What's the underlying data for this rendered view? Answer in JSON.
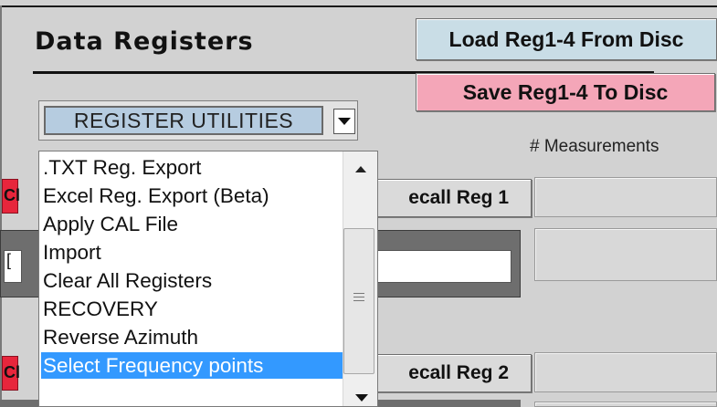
{
  "header": {
    "title": "Data Registers"
  },
  "buttons": {
    "load": "Load Reg1-4 From Disc",
    "save": "Save Reg1-4 To Disc"
  },
  "combo": {
    "selected": "REGISTER UTILITIES"
  },
  "dropdown": {
    "items": [
      ".TXT Reg. Export",
      "Excel Reg. Export (Beta)",
      "Apply CAL File",
      "Import",
      "Clear All Registers",
      "RECOVERY",
      "Reverse Azimuth",
      "Select Frequency points"
    ],
    "selected_item": "Select Frequency points"
  },
  "labels": {
    "measurements": "# Measurements"
  },
  "recall": {
    "reg1": "ecall Reg 1",
    "reg2": "ecall Reg 2"
  },
  "fragments": {
    "clear_fragment_1": "Cl",
    "clear_fragment_2": "Cl",
    "input_fragment": "["
  },
  "colors": {
    "load_button": "#c9dde6",
    "save_button": "#f4a6b8",
    "selection": "#3399ff",
    "clear_tab": "#e7263c"
  },
  "icons": {
    "combo_arrow": "chevron-down-icon",
    "scroll_up": "arrow-up-icon",
    "scroll_down": "arrow-down-icon"
  }
}
